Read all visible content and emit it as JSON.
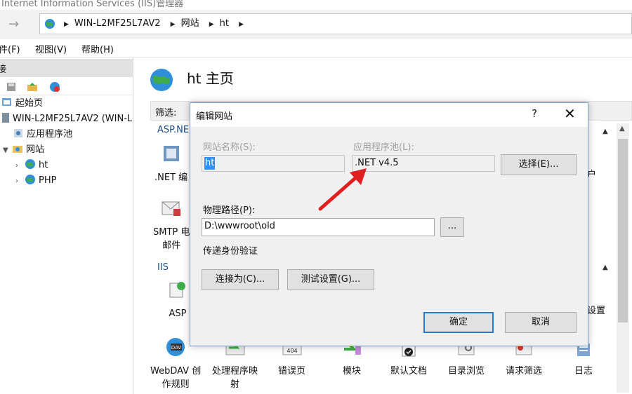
{
  "window": {
    "title": "Internet Information Services (IIS)管理器"
  },
  "address": {
    "crumbs": [
      "WIN-L2MF25L7AV2",
      "网站",
      "ht"
    ]
  },
  "menu": {
    "file": "件(F)",
    "view": "视图(V)",
    "help": "帮助(H)"
  },
  "left": {
    "header": "接",
    "tree": {
      "start": "起始页",
      "server": "WIN-L2MF25L7AV2 (WIN-L",
      "apppools": "应用程序池",
      "sites": "网站",
      "site_ht": "ht",
      "site_php": "PHP"
    }
  },
  "main": {
    "title": "ht 主页",
    "filter_label": "筛选:",
    "section_aspnet": "ASP.NE",
    "section_iis": "IIS",
    "features": {
      "net": ".NET 编",
      "smtp": "SMTP 电",
      "smtp2": "邮件",
      "asp": "ASP",
      "webdav": "WebDAV 创",
      "webdav2": "作规则",
      "handler": "处理程序映",
      "handler2": "射",
      "errors": "错误页",
      "modules": "模块",
      "defaultdoc": "默认文档",
      "dirbrowse": "目录浏览",
      "reqfilter": "请求筛选",
      "log": "日志",
      "users_partial": "户",
      "settings_partial": "设置"
    }
  },
  "dialog": {
    "title": "编辑网站",
    "help": "?",
    "close": "✕",
    "site_name_label": "网站名称(S):",
    "site_name_value": "ht",
    "app_pool_label": "应用程序池(L):",
    "app_pool_value": ".NET v4.5",
    "select_button": "选择(E)...",
    "physical_path_label": "物理路径(P):",
    "physical_path_value": "D:\\wwwroot\\old",
    "browse_button": "...",
    "passthrough_label": "传递身份验证",
    "connect_as_button": "连接为(C)...",
    "test_settings_button": "测试设置(G)...",
    "ok_button": "确定",
    "cancel_button": "取消"
  },
  "colors": {
    "arrow": "#e02020",
    "accent": "#2a7ad0"
  }
}
